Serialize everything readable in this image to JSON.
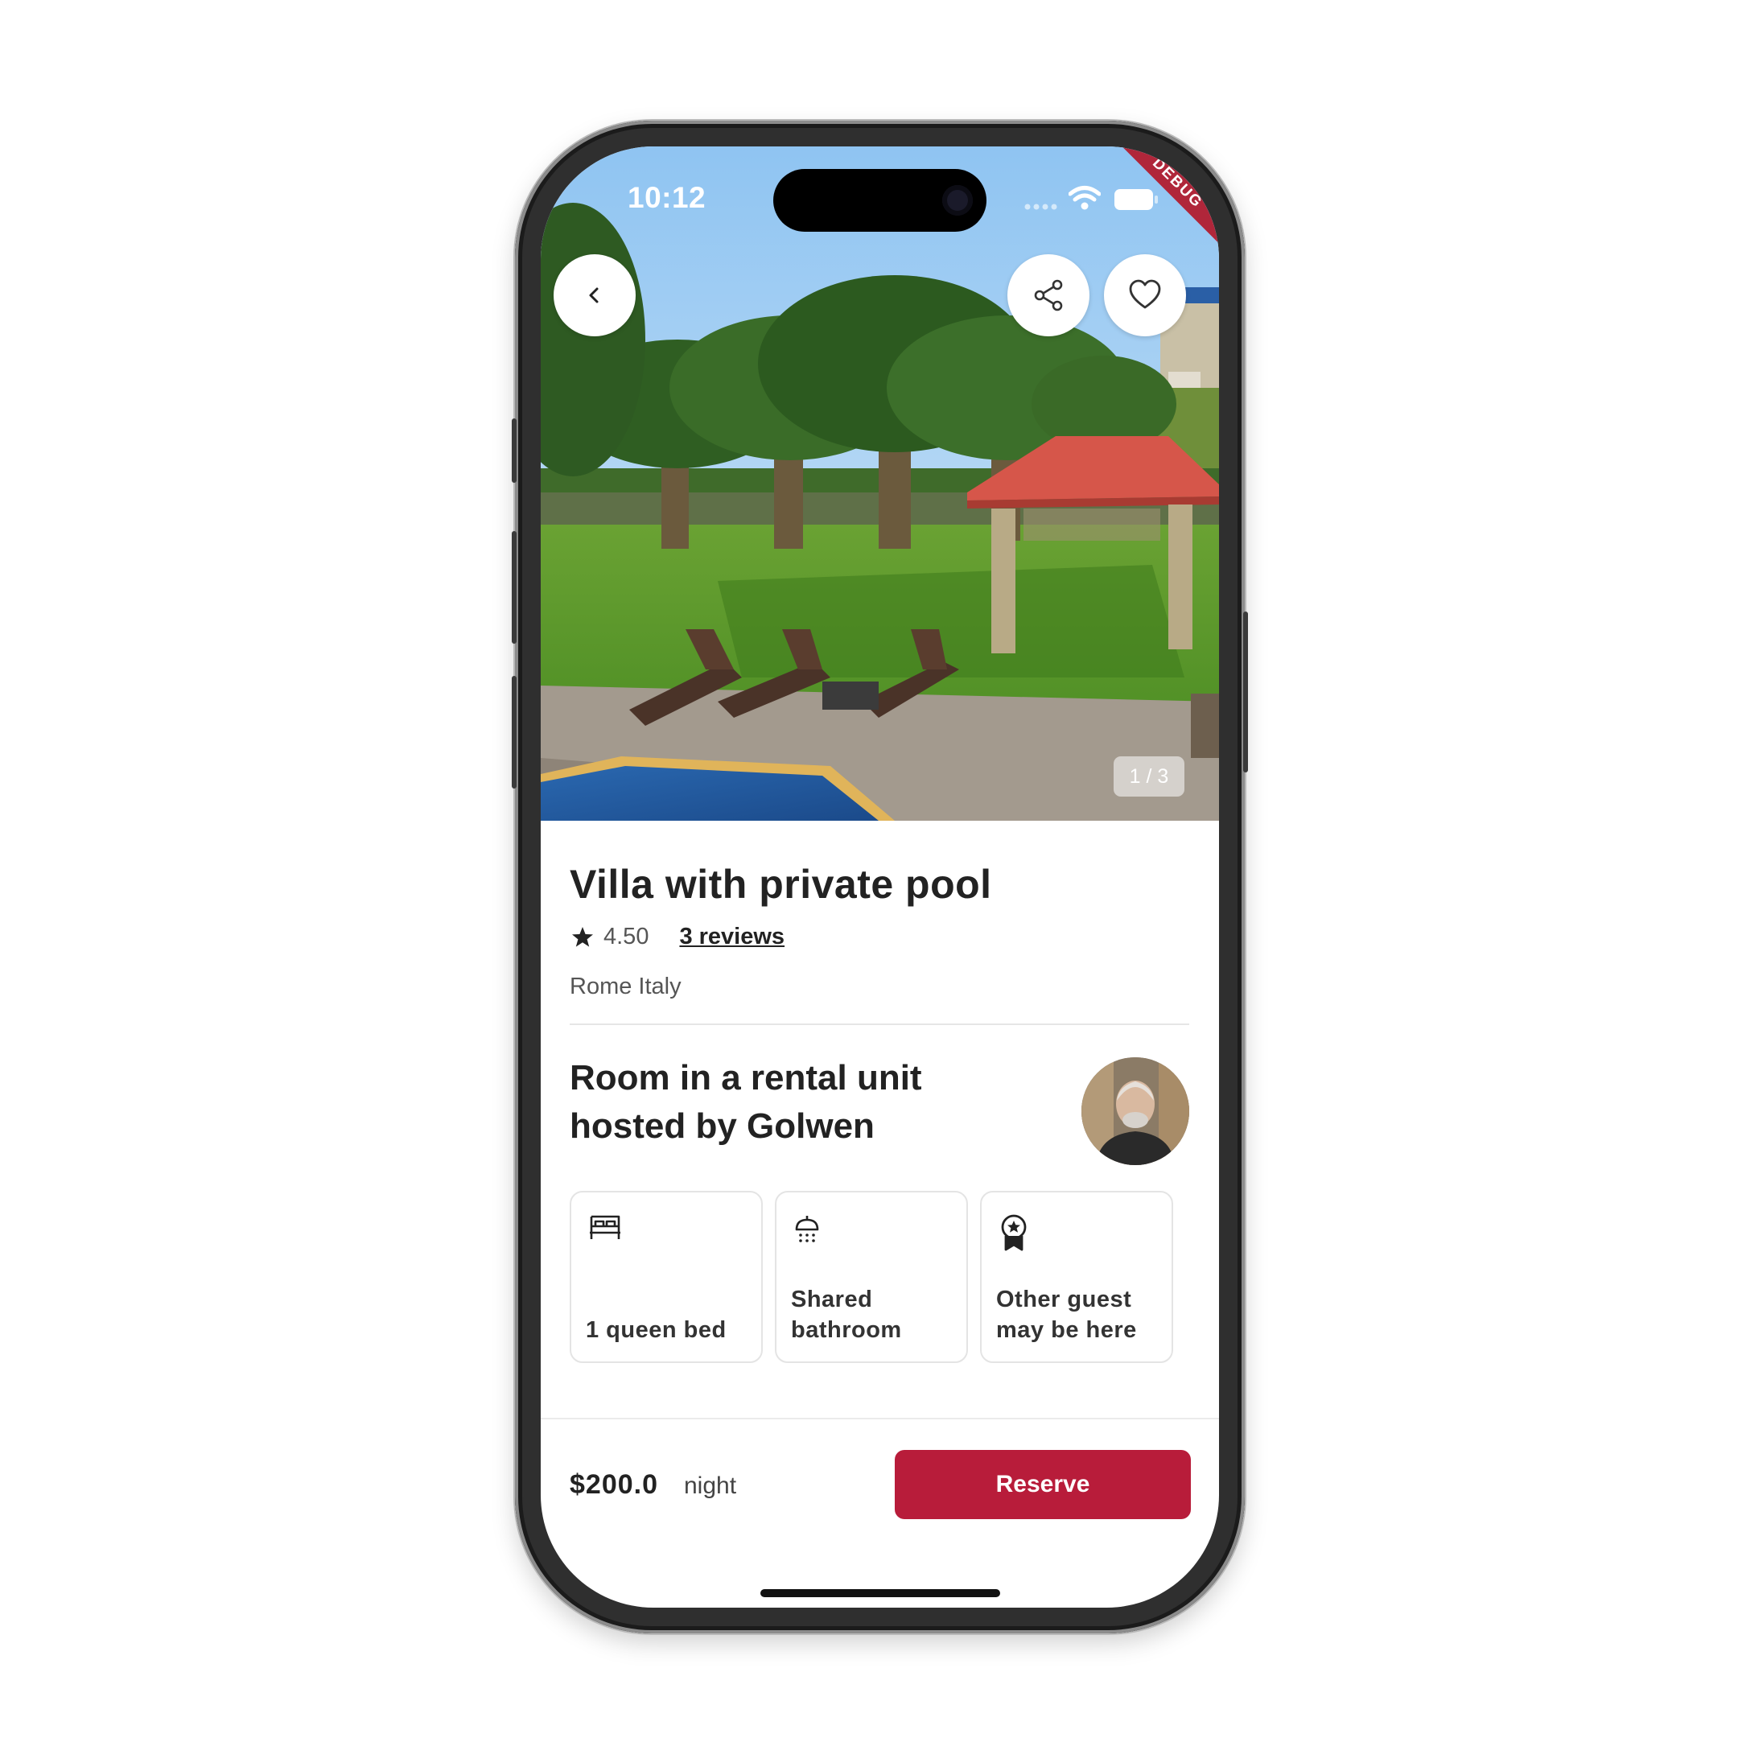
{
  "status_bar": {
    "time": "10:12",
    "debug_label": "DEBUG"
  },
  "gallery": {
    "counter": "1 / 3"
  },
  "listing": {
    "title": "Villa with private pool",
    "rating": "4.50",
    "reviews": "3 reviews",
    "location": "Rome Italy"
  },
  "host": {
    "title": "Room in a rental unit hosted by Golwen"
  },
  "features": [
    {
      "icon": "bed-icon",
      "label": "1 queen bed"
    },
    {
      "icon": "shower-icon",
      "label": "Shared bathroom"
    },
    {
      "icon": "award-icon",
      "label": "Other guest may be here"
    }
  ],
  "booking": {
    "price": "$200.0",
    "unit": "night",
    "reserve_label": "Reserve"
  },
  "colors": {
    "accent": "#b81c3a",
    "text": "#222222",
    "muted": "#555555"
  }
}
